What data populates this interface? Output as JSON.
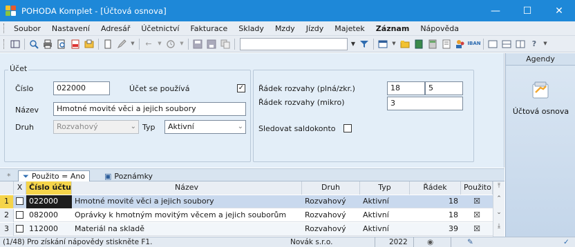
{
  "window": {
    "title": "POHODA Komplet - [Účtová osnova]",
    "minimize_glyph": "—",
    "maximize_glyph": "☐",
    "close_glyph": "✕"
  },
  "menu": [
    "Soubor",
    "Nastavení",
    "Adresář",
    "Účetnictví",
    "Fakturace",
    "Sklady",
    "Mzdy",
    "Jízdy",
    "Majetek",
    "Záznam",
    "Nápověda"
  ],
  "form": {
    "legend": "Účet",
    "cislo_label": "Číslo",
    "cislo_value": "022000",
    "ucet_pouziva_label": "Účet se používá",
    "ucet_pouziva_checked": true,
    "nazev_label": "Název",
    "nazev_value": "Hmotné movité věci a jejich soubory",
    "druh_label": "Druh",
    "druh_value": "Rozvahový",
    "typ_label": "Typ",
    "typ_value": "Aktivní",
    "radek_plna_label": "Řádek rozvahy (plná/zkr.)",
    "radek_plna_value1": "18",
    "radek_plna_value2": "5",
    "radek_mikro_label": "Řádek rozvahy (mikro)",
    "radek_mikro_value": "3",
    "saldokonto_label": "Sledovat saldokonto",
    "saldokonto_checked": false
  },
  "agenda": {
    "header": "Agendy",
    "item_label": "Účtová osnova"
  },
  "tabs": {
    "asterisk": "*",
    "filter_tab": "Použito = Ano",
    "notes_tab": "Poznámky"
  },
  "table": {
    "headers": {
      "x": "X",
      "cislo": "Číslo účtu",
      "nazev": "Název",
      "druh": "Druh",
      "typ": "Typ",
      "radek": "Řádek",
      "pouzito": "Použito"
    },
    "rows": [
      {
        "no": "1",
        "cislo": "022000",
        "nazev": "Hmotné movité věci a jejich soubory",
        "druh": "Rozvahový",
        "typ": "Aktivní",
        "radek": "18",
        "pouzito": "☒"
      },
      {
        "no": "2",
        "cislo": "082000",
        "nazev": "Oprávky k hmotným movitým věcem a jejich souborům",
        "druh": "Rozvahový",
        "typ": "Aktivní",
        "radek": "18",
        "pouzito": "☒"
      },
      {
        "no": "3",
        "cislo": "112000",
        "nazev": "Materiál na skladě",
        "druh": "Rozvahový",
        "typ": "Aktivní",
        "radek": "39",
        "pouzito": "☒"
      }
    ]
  },
  "status": {
    "help": "(1/48) Pro získání nápovědy stiskněte F1.",
    "company": "Novák s.r.o.",
    "year": "2022"
  },
  "colors": {
    "titlebar": "#1e88d8",
    "selected_row": "#c9d9ee",
    "current_cell": "#1d1d1d"
  }
}
